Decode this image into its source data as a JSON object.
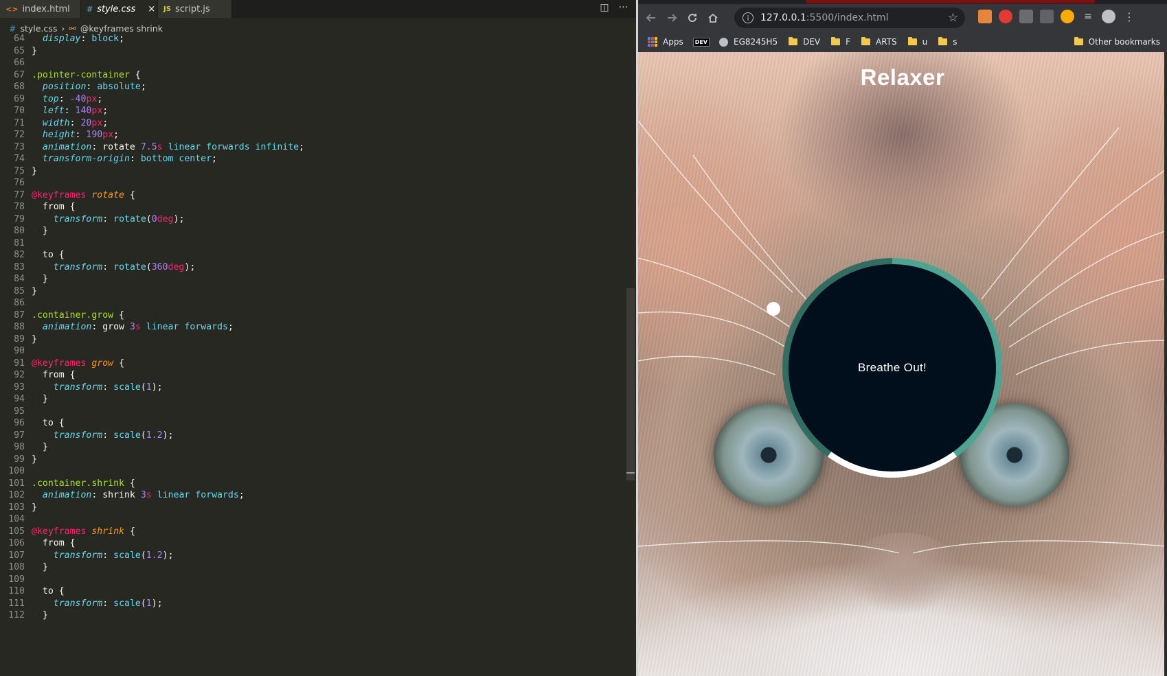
{
  "editor": {
    "tabs": [
      {
        "icon": "<>",
        "label": "index.html"
      },
      {
        "icon": "#",
        "label": "style.css",
        "close": "×"
      },
      {
        "icon": "JS",
        "label": "script.js"
      }
    ],
    "breadcrumb": {
      "file": "style.css",
      "symbol": "@keyframes shrink"
    },
    "actions": {
      "split": "◫",
      "more": "···"
    }
  },
  "code_lines": [
    {
      "n": "64",
      "html": "  <span class=\"prop\">display</span>: <span class=\"val\">block</span>;"
    },
    {
      "n": "65",
      "html": "}"
    },
    {
      "n": "66",
      "html": ""
    },
    {
      "n": "67",
      "html": "<span class=\"sel\">.pointer-container</span> {"
    },
    {
      "n": "68",
      "html": "  <span class=\"prop\">position</span>: <span class=\"val\">absolute</span>;"
    },
    {
      "n": "69",
      "html": "  <span class=\"prop\">top</span>: <span class=\"num\">-40</span><span class=\"unit\">px</span>;"
    },
    {
      "n": "70",
      "html": "  <span class=\"prop\">left</span>: <span class=\"num\">140</span><span class=\"unit\">px</span>;"
    },
    {
      "n": "71",
      "html": "  <span class=\"prop\">width</span>: <span class=\"num\">20</span><span class=\"unit\">px</span>;"
    },
    {
      "n": "72",
      "html": "  <span class=\"prop\">height</span>: <span class=\"num\">190</span><span class=\"unit\">px</span>;"
    },
    {
      "n": "73",
      "html": "  <span class=\"prop\">animation</span>: rotate <span class=\"num\">7.5</span><span class=\"unit\">s</span> <span class=\"val\">linear forwards infinite</span>;"
    },
    {
      "n": "74",
      "html": "  <span class=\"prop\">transform-origin</span>: <span class=\"val\">bottom center</span>;"
    },
    {
      "n": "75",
      "html": "}"
    },
    {
      "n": "76",
      "html": ""
    },
    {
      "n": "77",
      "html": "<span class=\"kw\">@keyframes</span> <span class=\"name\">rotate</span> {"
    },
    {
      "n": "78",
      "html": "  from {"
    },
    {
      "n": "79",
      "html": "    <span class=\"prop\">transform</span>: <span class=\"val\">rotate</span>(<span class=\"num\">0</span><span class=\"unit\">deg</span>);"
    },
    {
      "n": "80",
      "html": "  }"
    },
    {
      "n": "81",
      "html": ""
    },
    {
      "n": "82",
      "html": "  to {"
    },
    {
      "n": "83",
      "html": "    <span class=\"prop\">transform</span>: <span class=\"val\">rotate</span>(<span class=\"num\">360</span><span class=\"unit\">deg</span>);"
    },
    {
      "n": "84",
      "html": "  }"
    },
    {
      "n": "85",
      "html": "}"
    },
    {
      "n": "86",
      "html": ""
    },
    {
      "n": "87",
      "html": "<span class=\"sel\">.container.grow</span> {"
    },
    {
      "n": "88",
      "html": "  <span class=\"prop\">animation</span>: grow <span class=\"num\">3</span><span class=\"unit\">s</span> <span class=\"val\">linear forwards</span>;"
    },
    {
      "n": "89",
      "html": "}"
    },
    {
      "n": "90",
      "html": ""
    },
    {
      "n": "91",
      "html": "<span class=\"kw\">@keyframes</span> <span class=\"name\">grow</span> {"
    },
    {
      "n": "92",
      "html": "  from {"
    },
    {
      "n": "93",
      "html": "    <span class=\"prop\">transform</span>: <span class=\"val\">scale</span>(<span class=\"num\">1</span>);"
    },
    {
      "n": "94",
      "html": "  }"
    },
    {
      "n": "95",
      "html": ""
    },
    {
      "n": "96",
      "html": "  to {"
    },
    {
      "n": "97",
      "html": "    <span class=\"prop\">transform</span>: <span class=\"val\">scale</span>(<span class=\"num\">1.2</span>);"
    },
    {
      "n": "98",
      "html": "  }"
    },
    {
      "n": "99",
      "html": "}"
    },
    {
      "n": "100",
      "html": ""
    },
    {
      "n": "101",
      "html": "<span class=\"sel\">.container.shrink</span> {"
    },
    {
      "n": "102",
      "html": "  <span class=\"prop\">animation</span>: shrink <span class=\"num\">3</span><span class=\"unit\">s</span> <span class=\"val\">linear forwards</span>;"
    },
    {
      "n": "103",
      "html": "}"
    },
    {
      "n": "104",
      "html": ""
    },
    {
      "n": "105",
      "html": "<span class=\"kw\">@keyframes</span> <span class=\"name\">shrink</span> {"
    },
    {
      "n": "106",
      "html": "  from {"
    },
    {
      "n": "107",
      "html": "    <span class=\"prop\">transform</span>: <span class=\"val\">scale</span>(<span class=\"num\">1.2</span>);"
    },
    {
      "n": "108",
      "html": "  }"
    },
    {
      "n": "109",
      "html": ""
    },
    {
      "n": "110",
      "html": "  to {"
    },
    {
      "n": "111",
      "html": "    <span class=\"prop\">transform</span>: <span class=\"val\">scale</span>(<span class=\"num\">1</span>);"
    },
    {
      "n": "112",
      "html": "  }"
    }
  ],
  "browser": {
    "url_host": "127.0.0.1",
    "url_path": ":5500/index.html",
    "bookmarks": [
      {
        "type": "apps",
        "label": "Apps"
      },
      {
        "type": "dev",
        "label": "DEV"
      },
      {
        "type": "globe",
        "label": "EG8245H5"
      },
      {
        "type": "folder",
        "label": "DEV"
      },
      {
        "type": "folder",
        "label": "F"
      },
      {
        "type": "folder",
        "label": "ARTS"
      },
      {
        "type": "folder",
        "label": "u"
      },
      {
        "type": "folder",
        "label": "s"
      }
    ],
    "other_bookmarks": "Other bookmarks"
  },
  "page": {
    "title": "Relaxer",
    "status_text": "Breathe Out!"
  },
  "colors": {
    "ring_mid": "#4ca493",
    "ring_dark": "#336d62",
    "ring_light": "#ffffff",
    "circle_fill": "#010f1c",
    "editor_bg": "#272822"
  }
}
